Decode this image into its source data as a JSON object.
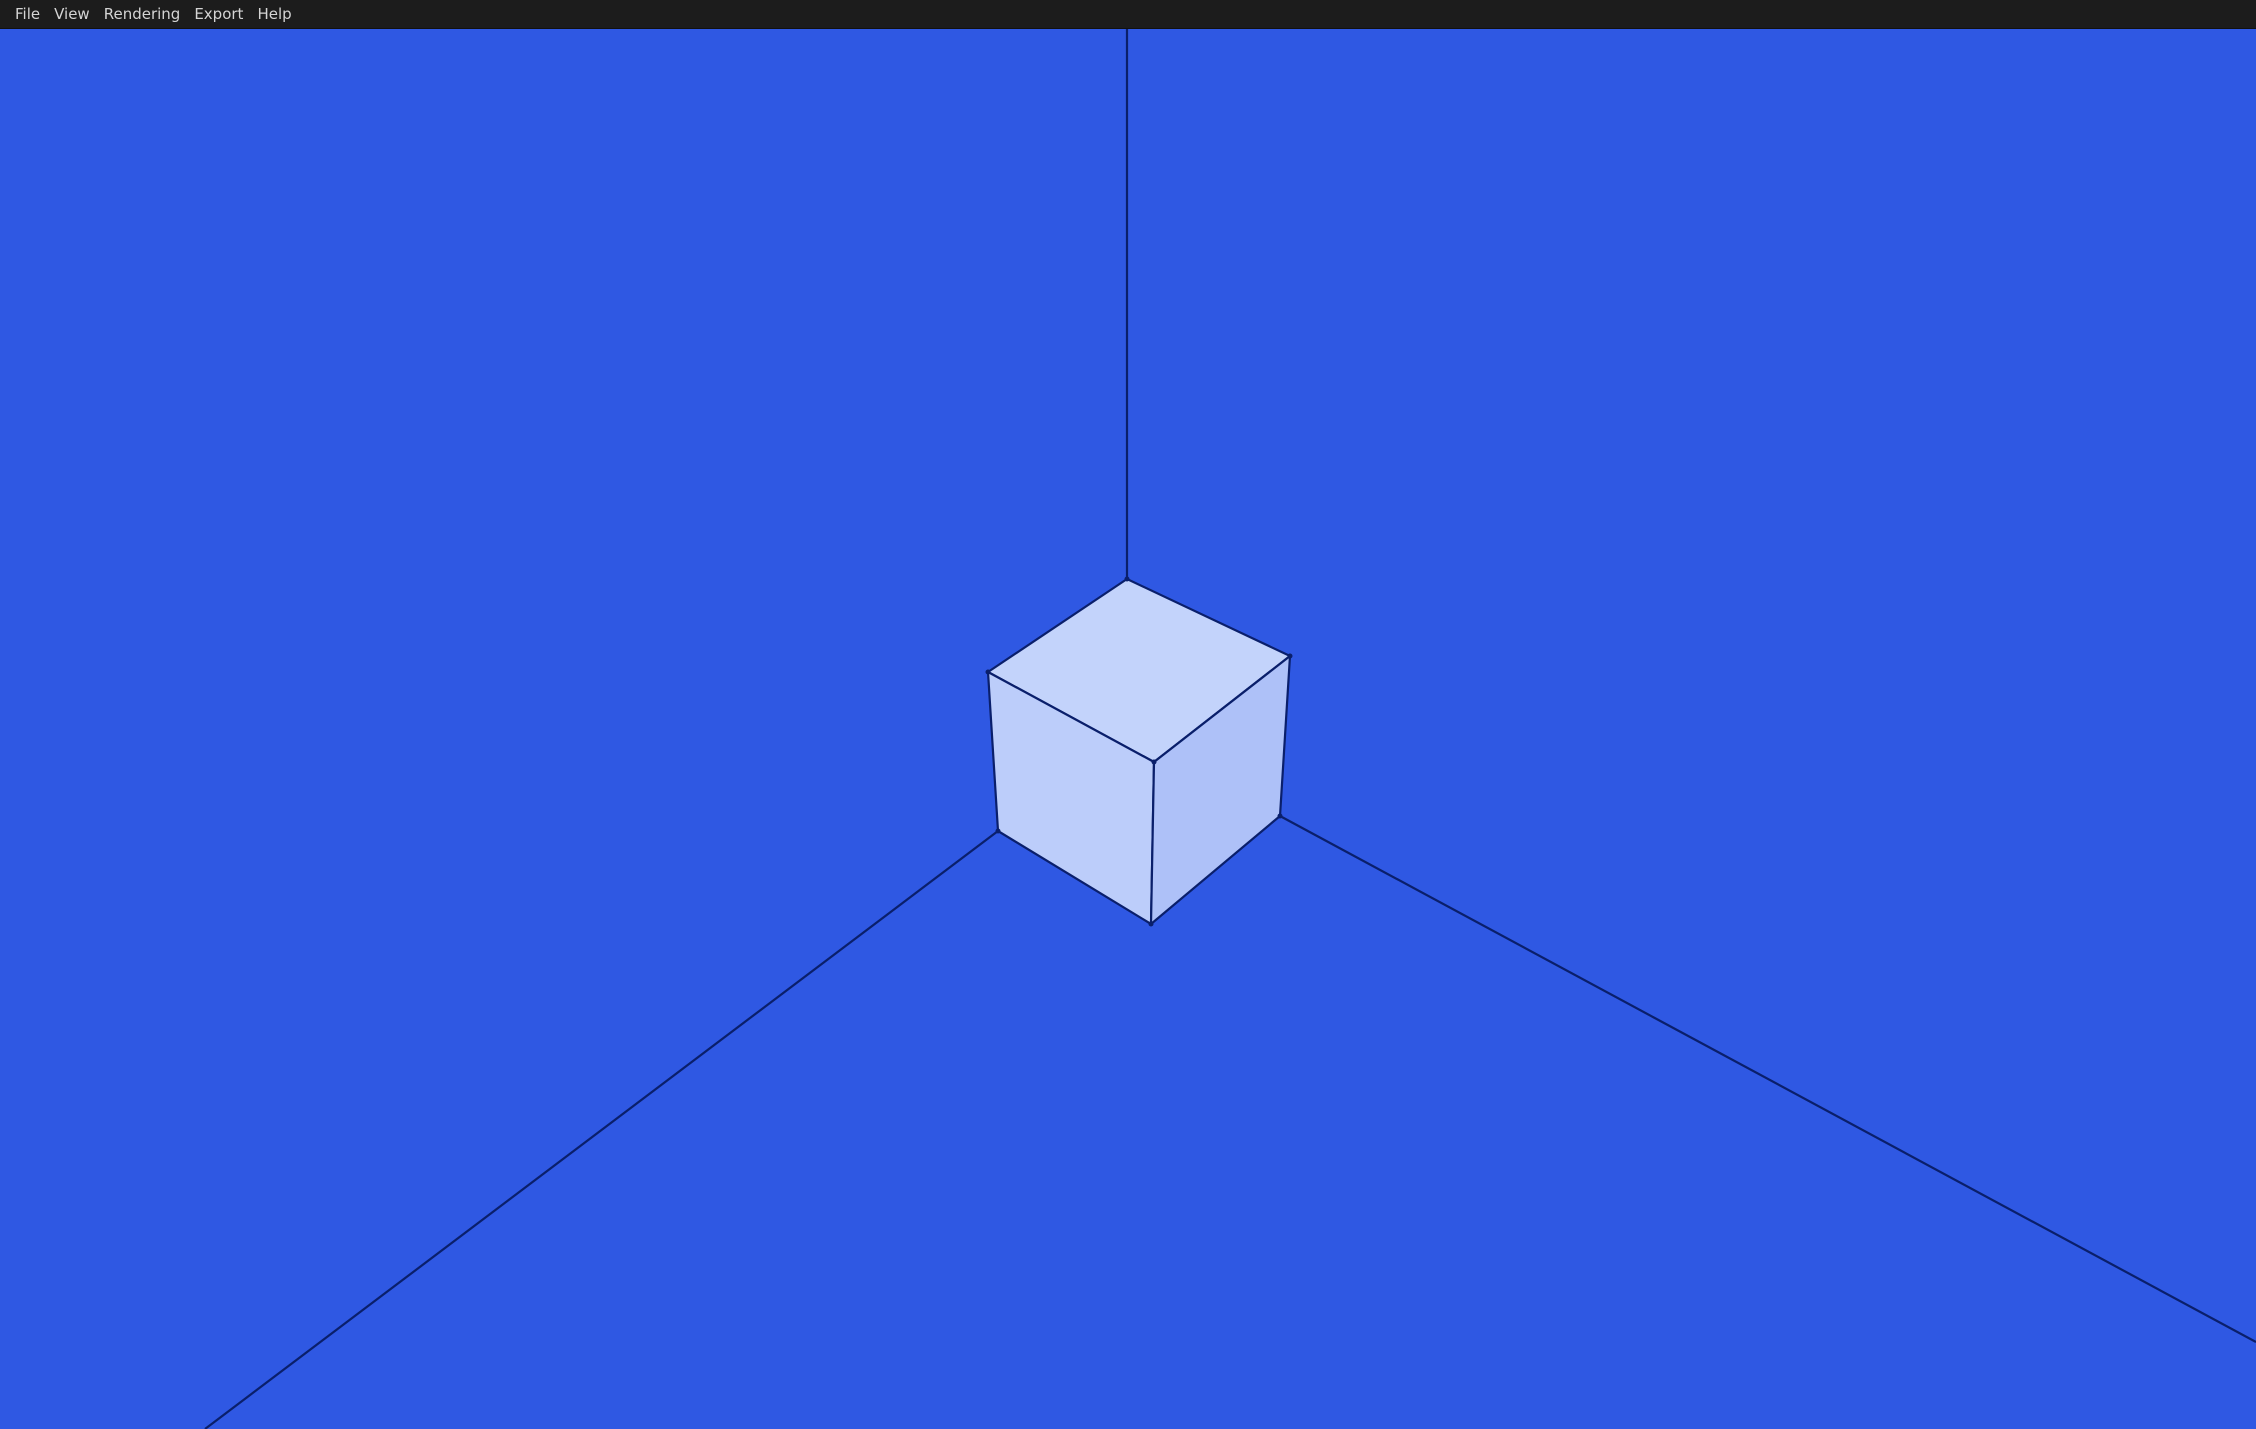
{
  "menubar": {
    "items": [
      {
        "label": "File"
      },
      {
        "label": "View"
      },
      {
        "label": "Rendering"
      },
      {
        "label": "Export"
      },
      {
        "label": "Help"
      }
    ]
  },
  "scene": {
    "background_color": "#2f58e3",
    "edge_color": "#0a1f6b",
    "objects": [
      {
        "type": "cube",
        "top_face_color": "#c2d2fb",
        "left_face_color": "#bdcdfa",
        "right_face_color": "#adc0f8"
      },
      {
        "type": "axis-lines",
        "count": 3
      }
    ]
  }
}
